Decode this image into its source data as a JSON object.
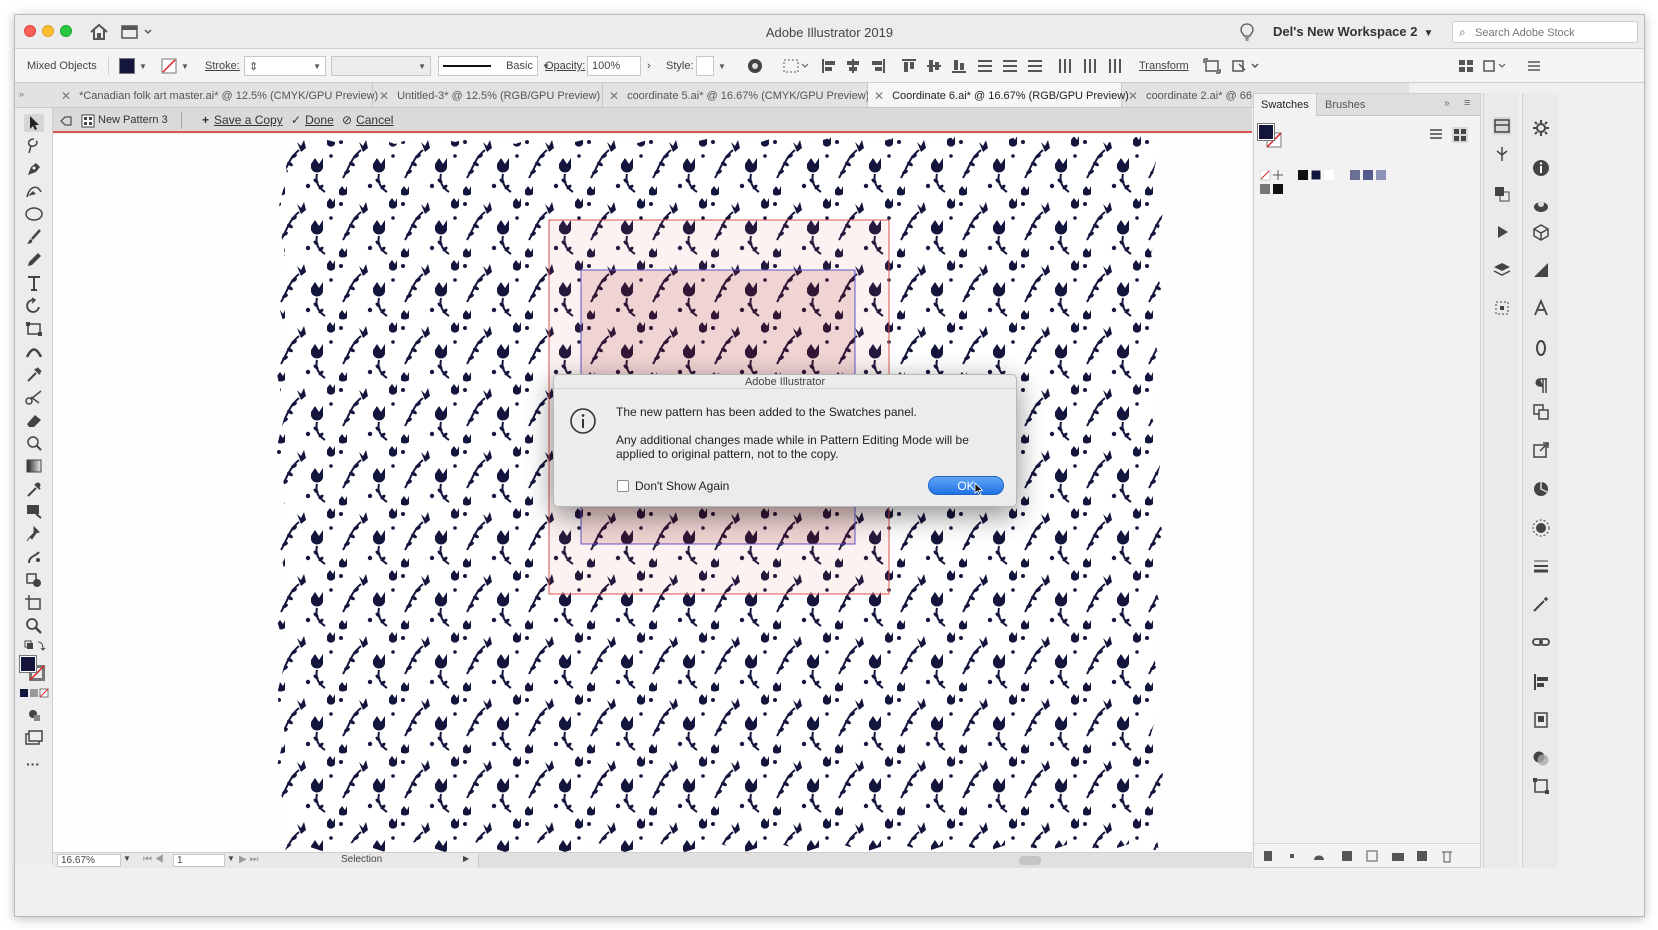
{
  "app": {
    "title": "Adobe Illustrator 2019",
    "workspace": "Del's New Workspace 2",
    "stock_search_placeholder": "Search Adobe Stock"
  },
  "control_bar": {
    "selection_label": "Mixed Objects",
    "stroke_label": "Stroke:",
    "brush_label": "Basic",
    "opacity_label": "Opacity:",
    "opacity_value": "100%",
    "style_label": "Style:",
    "transform_label": "Transform"
  },
  "tabs": [
    {
      "label": "*Canadian folk art master.ai* @ 12.5% (CMYK/GPU Preview)",
      "active": false
    },
    {
      "label": "Untitled-3* @ 12.5% (RGB/GPU Preview)",
      "active": false
    },
    {
      "label": "coordinate 5.ai* @ 16.67% (CMYK/GPU Preview)",
      "active": false
    },
    {
      "label": "Coordinate 6.ai* @ 16.67% (RGB/GPU Preview)",
      "active": true
    },
    {
      "label": "coordinate 2.ai* @ 66.",
      "active": false
    }
  ],
  "pattern_bar": {
    "pattern_name": "New Pattern 3",
    "save_copy": "Save a Copy",
    "done": "Done",
    "cancel": "Cancel"
  },
  "status_bar": {
    "zoom": "16.67%",
    "artboard": "1",
    "tool_status": "Selection"
  },
  "swatches_panel": {
    "tabs": [
      "Swatches",
      "Brushes"
    ]
  },
  "dialog": {
    "title": "Adobe Illustrator",
    "message_1": "The new pattern has been added to the Swatches panel.",
    "message_2": "Any additional changes made while in Pattern Editing Mode will be applied to original pattern, not to the copy.",
    "checkbox_label": "Don't Show Again",
    "ok_label": "OK"
  },
  "colors": {
    "fill": "#14153d",
    "pattern_ink": "#14153d",
    "accent_red": "#d9534f",
    "ok_blue": "#2171e5"
  }
}
